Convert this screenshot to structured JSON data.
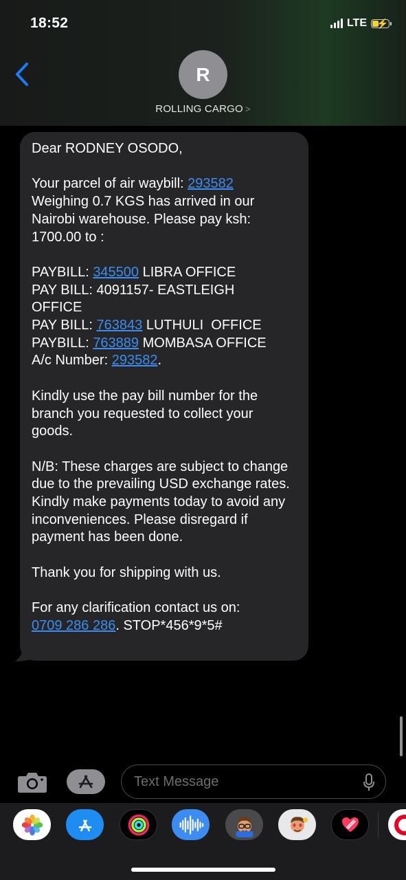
{
  "status_bar": {
    "time": "18:52",
    "network": "LTE"
  },
  "header": {
    "avatar_letter": "R",
    "contact_name": "ROLLING CARGO",
    "contact_chevron": ">"
  },
  "message": {
    "greeting": "Dear RODNEY OSODO,",
    "p1_a": "Your parcel of air waybill: ",
    "p1_link": "293582",
    "p1_b": "Weighing 0.7 KGS has arrived in our Nairobi warehouse. Please pay ksh: 1700.00 to :",
    "pb1_label": "PAYBILL: ",
    "pb1_num": "345500",
    "pb1_office": " LIBRA OFFICE",
    "pb2_text": "PAY BILL: 4091157- EASTLEIGH OFFICE",
    "pb3_label": "PAY BILL: ",
    "pb3_num": "763843",
    "pb3_office": " LUTHULI  OFFICE",
    "pb4_label": "PAYBILL: ",
    "pb4_num": "763889",
    "pb4_office": " MOMBASA OFFICE",
    "ac_label": "A/c Number: ",
    "ac_num": "293582",
    "ac_end": ".",
    "p3": "Kindly use the pay bill number for the branch you requested to collect your goods.",
    "p4": "N/B: These charges are subject to change due to the prevailing USD exchange rates. Kindly make payments today to avoid any inconveniences. Please disregard if payment has been done.",
    "p5": "Thank you for shipping with us.",
    "p6": "For any clarification contact us on:",
    "phone": "0709 286 286",
    "stop": ". STOP*456*9*5#"
  },
  "composer": {
    "placeholder": "Text Message"
  },
  "app_tray": {
    "apps": [
      "photos-app-icon",
      "app-store-icon",
      "fitness-app-icon",
      "audio-message-icon",
      "memoji-icon",
      "memoji-stickers-icon",
      "digital-touch-icon",
      "partial-app-icon"
    ]
  },
  "colors": {
    "link": "#3b8df2",
    "bubble": "#262628",
    "accent": "#1a7cf5"
  }
}
